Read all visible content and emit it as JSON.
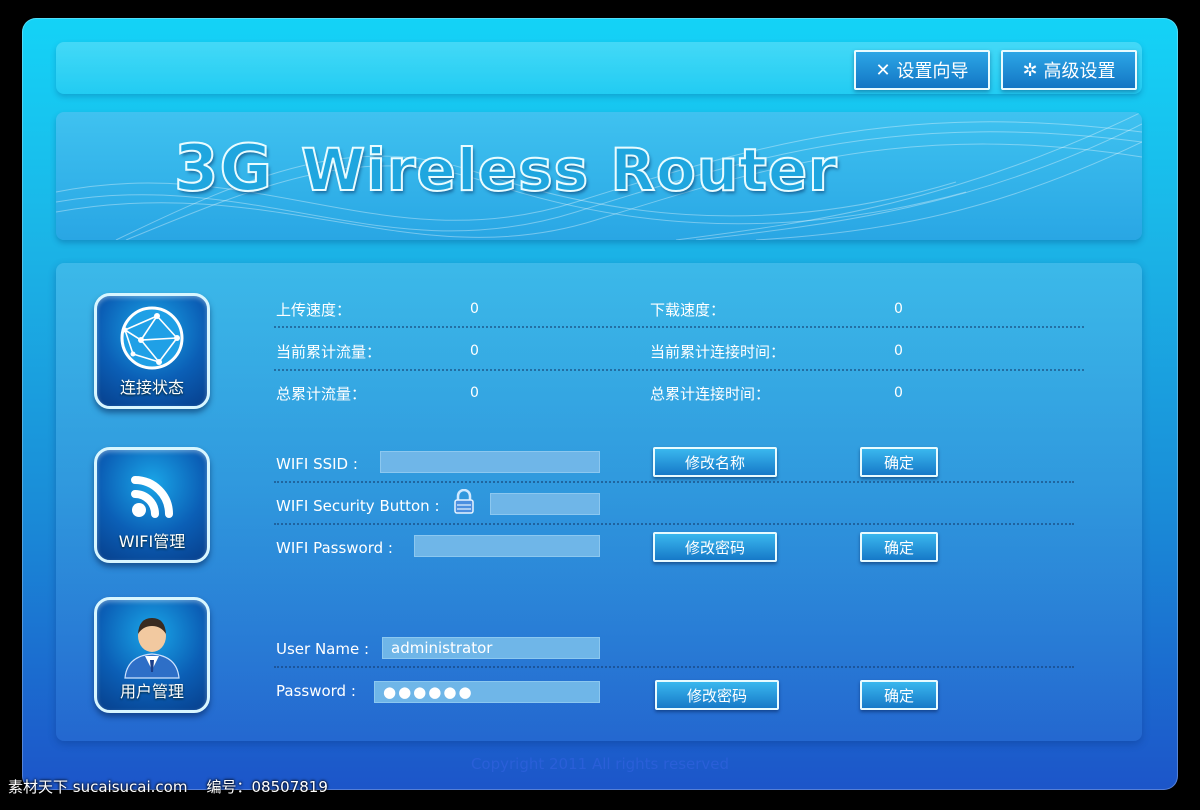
{
  "topbar": {
    "wizard_label": "设置向导",
    "wizard_icon": "x-tools-icon",
    "advanced_label": "高级设置",
    "advanced_icon": "gear-icon"
  },
  "banner": {
    "brand_3g": "3G",
    "brand_name": "Wireless Router"
  },
  "status": {
    "tile_label": "连接状态",
    "upload_label": "上传速度：",
    "upload_value": "0",
    "download_label": "下载速度：",
    "download_value": "0",
    "cur_traffic_label": "当前累计流量：",
    "cur_traffic_value": "0",
    "cur_time_label": "当前累计连接时间：",
    "cur_time_value": "0",
    "total_traffic_label": "总累计流量：",
    "total_traffic_value": "0",
    "total_time_label": "总累计连接时间：",
    "total_time_value": "0"
  },
  "wifi": {
    "tile_label": "WIFI管理",
    "ssid_label": "WIFI SSID :",
    "ssid_value": "",
    "rename_button": "修改名称",
    "rename_confirm": "确定",
    "security_label": "WIFI Security Button :",
    "security_value": "",
    "password_label": "WIFI Password :",
    "password_value": "",
    "change_pw_button": "修改密码",
    "pw_confirm": "确定"
  },
  "user": {
    "tile_label": "用户管理",
    "username_label": "User Name :",
    "username_value": "administrator",
    "password_label": "Password :",
    "password_value": "●●●●●●",
    "change_pw_button": "修改密码",
    "pw_confirm": "确定"
  },
  "footer": {
    "copyright": "Copyright 2011 All rights reserved"
  },
  "watermark": {
    "left": "素材天下 sucaisucai.com",
    "right": "编号：08507819"
  },
  "colors": {
    "accent": "#1fa6df",
    "button_top": "#3ab7ee",
    "button_bottom": "#1679c8"
  }
}
